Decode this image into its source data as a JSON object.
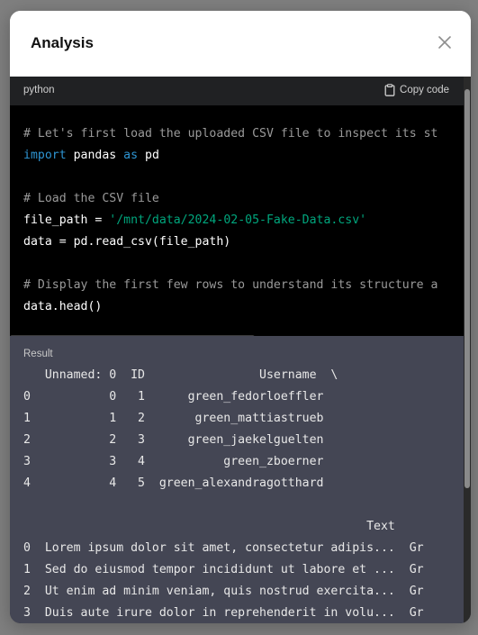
{
  "modal": {
    "title": "Analysis"
  },
  "code_block": {
    "language": "python",
    "copy_label": "Copy code",
    "lines": {
      "l1": "# Let's first load the uploaded CSV file to inspect its st",
      "l2_kw": "import",
      "l2_a": " pandas ",
      "l2_kw2": "as",
      "l2_b": " pd",
      "l4": "# Load the CSV file",
      "l5_a": "file_path = ",
      "l5_str": "'/mnt/data/2024-02-05-Fake-Data.csv'",
      "l6": "data = pd.read_csv(file_path)",
      "l8": "# Display the first few rows to understand its structure a",
      "l9": "data.head()"
    }
  },
  "result": {
    "label": "Result",
    "lines": [
      "   Unnamed: 0  ID                Username  \\",
      "0           0   1      green_fedorloeffler",
      "1           1   2       green_mattiastrueb",
      "2           2   3      green_jaekelguelten",
      "3           3   4           green_zboerner",
      "4           4   5  green_alexandragotthard",
      "",
      "                                                Text  ",
      "0  Lorem ipsum dolor sit amet, consectetur adipis...  Gr",
      "1  Sed do eiusmod tempor incididunt ut labore et ...  Gr",
      "2  Ut enim ad minim veniam, quis nostrud exercita...  Gr",
      "3  Duis aute irure dolor in reprehenderit in volu...  Gr"
    ]
  },
  "colors": {
    "overlay": "#7f7f7f",
    "code_bg": "#000000",
    "code_header_bg": "#202123",
    "result_bg": "#444654",
    "keyword": "#2e95d3",
    "string": "#00a67d",
    "comment": "#9a9a9a"
  },
  "icons": {
    "close": "close-icon",
    "copy": "clipboard-icon"
  }
}
